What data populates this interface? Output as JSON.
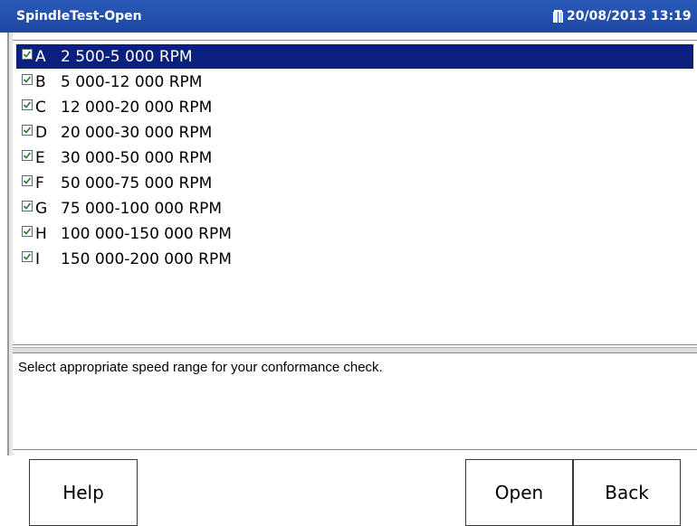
{
  "window": {
    "title": "SpindleTest-Open",
    "datetime": "20/08/2013 13:19",
    "battery_icon": "battery-icon"
  },
  "speed_list": {
    "selected_index": 0,
    "items": [
      {
        "letter": "A",
        "range": "2 500-5 000 RPM",
        "checked": true
      },
      {
        "letter": "B",
        "range": "5 000-12 000 RPM",
        "checked": true
      },
      {
        "letter": "C",
        "range": "12 000-20 000 RPM",
        "checked": true
      },
      {
        "letter": "D",
        "range": "20 000-30 000 RPM",
        "checked": true
      },
      {
        "letter": "E",
        "range": "30 000-50 000 RPM",
        "checked": true
      },
      {
        "letter": "F",
        "range": "50 000-75 000 RPM",
        "checked": true
      },
      {
        "letter": "G",
        "range": "75 000-100 000 RPM",
        "checked": true
      },
      {
        "letter": "H",
        "range": "100 000-150 000 RPM",
        "checked": true
      },
      {
        "letter": "I",
        "range": "150 000-200 000 RPM",
        "checked": true
      }
    ]
  },
  "message": {
    "text": "Select appropriate speed range for your conformance check."
  },
  "buttons": {
    "help": "Help",
    "open": "Open",
    "back": "Back"
  },
  "colors": {
    "titlebar": "#1d47a2",
    "selection": "#0a1f7e"
  }
}
